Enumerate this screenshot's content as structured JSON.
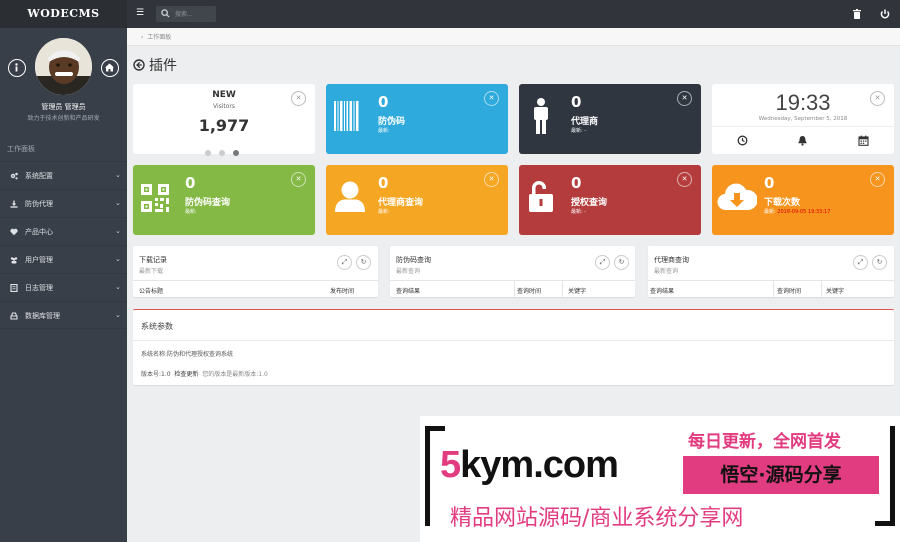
{
  "topbar": {
    "brand": "WODECMS",
    "search_placeholder": "搜索..."
  },
  "sidebar": {
    "username": "管理员 管理员",
    "description": "致力于技术创新和产品研发",
    "section_title": "工作面板",
    "items": [
      {
        "label": "系统配置",
        "icon": "cogs-icon"
      },
      {
        "label": "防伪代理",
        "icon": "download-icon"
      },
      {
        "label": "产品中心",
        "icon": "heart-icon"
      },
      {
        "label": "用户管理",
        "icon": "users-icon"
      },
      {
        "label": "日志管理",
        "icon": "log-icon"
      },
      {
        "label": "数据库管理",
        "icon": "database-icon"
      }
    ]
  },
  "breadcrumb": "工作面板",
  "page_title": "插件",
  "visitors": {
    "title": "NEW",
    "subtitle": "Visitors",
    "value": "1,977"
  },
  "cards": [
    {
      "value": "0",
      "label": "防伪码",
      "sub": "最新: ",
      "highlight": "",
      "color": "#2eaadc",
      "icon": "barcode-icon"
    },
    {
      "value": "0",
      "label": "代理商",
      "sub": "最新: -",
      "highlight": "",
      "color": "#2f3640",
      "icon": "male-icon"
    },
    {
      "value": "0",
      "label": "防伪码查询",
      "sub": "最新: ",
      "highlight": "",
      "color": "#83b944",
      "icon": "qrcode-icon"
    },
    {
      "value": "0",
      "label": "代理商查询",
      "sub": "最新: ",
      "highlight": "",
      "color": "#f5a623",
      "icon": "user-icon"
    },
    {
      "value": "0",
      "label": "授权查询",
      "sub": "最新: -",
      "highlight": "",
      "color": "#b43c3c",
      "icon": "unlock-icon"
    },
    {
      "value": "0",
      "label": "下载次数",
      "sub": "最新: ",
      "highlight": "2018-09-05 19:33:17",
      "color": "#f7941d",
      "icon": "cloud-download-icon"
    }
  ],
  "clock": {
    "time": "19:33",
    "date": "Wednesday, September 5, 2018"
  },
  "panels": [
    {
      "title": "下载记录",
      "subtitle": "最新下载",
      "columns": [
        "公告标题",
        "发布时间"
      ]
    },
    {
      "title": "防伪码查询",
      "subtitle": "最新查询",
      "columns": [
        "查询结果",
        "查询时间",
        "关键字"
      ]
    },
    {
      "title": "代理商查询",
      "subtitle": "最新查询",
      "columns": [
        "查询结果",
        "查询时间",
        "关键字"
      ]
    }
  ],
  "system": {
    "title": "系统参数",
    "system_name": "系统名称:防伪和代理授权查询系统",
    "version": "版本号:1.0",
    "check_update": "检查更新",
    "latest_version": "您的版本是最新版本:1.0"
  },
  "ad": {
    "slogan": "每日更新，全网首发",
    "domain": "5kym.com",
    "badge": "悟空·源码分享",
    "tagline": "精品网站源码/商业系统分享网"
  }
}
